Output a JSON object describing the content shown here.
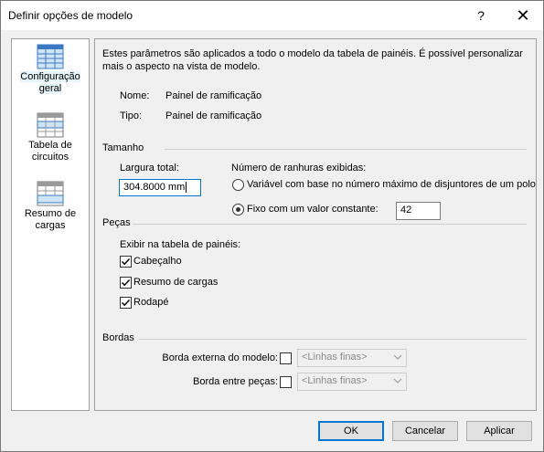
{
  "window": {
    "title": "Definir opções de modelo",
    "help_glyph": "?",
    "close_glyph": "✕"
  },
  "sidebar": {
    "items": [
      {
        "label": "Configuração geral",
        "icon": "general-settings-icon",
        "selected": true
      },
      {
        "label": "Tabela de circuitos",
        "icon": "circuit-table-icon",
        "selected": false
      },
      {
        "label": "Resumo de cargas",
        "icon": "load-summary-icon",
        "selected": false
      }
    ]
  },
  "content": {
    "description": "Estes parâmetros são aplicados a todo o modelo da tabela de painéis. É possível personalizar mais o aspecto na vista de modelo.",
    "name_label": "Nome:",
    "name_value": "Painel de ramificação",
    "type_label": "Tipo:",
    "type_value": "Painel de ramificação",
    "size_section": {
      "title": "Tamanho",
      "width_label": "Largura total:",
      "width_value": "304.8000 mm",
      "slots_label": "Número de ranhuras exibidas:",
      "option_variable": "Variável com base no número máximo de disjuntores de um polo",
      "option_fixed": "Fixo com um valor constante:",
      "fixed_value": "42",
      "selected_option": "fixed"
    },
    "parts_section": {
      "title": "Peças",
      "show_label": "Exibir na tabela de painéis:",
      "header_label": "Cabeçalho",
      "header_checked": true,
      "summary_label": "Resumo de cargas",
      "summary_checked": true,
      "footer_label": "Rodapé",
      "footer_checked": true
    },
    "borders_section": {
      "title": "Bordas",
      "outer_label": "Borda externa do modelo:",
      "outer_checked": false,
      "outer_select": "<Linhas finas>",
      "inner_label": "Borda entre peças:",
      "inner_checked": false,
      "inner_select": "<Linhas finas>"
    }
  },
  "footer": {
    "ok": "OK",
    "cancel": "Cancelar",
    "apply": "Aplicar"
  },
  "colors": {
    "accent": "#0078d7",
    "selected_bg": "#e5f3fb",
    "icon_blue": "#3a78c4"
  }
}
